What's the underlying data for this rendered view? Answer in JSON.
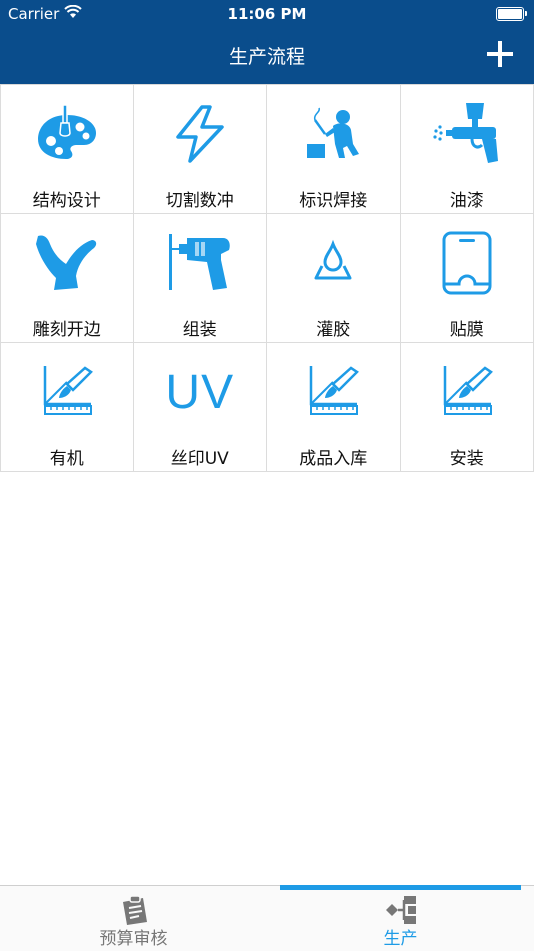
{
  "status_bar": {
    "carrier": "Carrier",
    "time": "11:06 PM"
  },
  "nav": {
    "title": "生产流程"
  },
  "grid": [
    {
      "label": "结构设计",
      "icon": "palette-icon"
    },
    {
      "label": "切割数冲",
      "icon": "lightning-icon"
    },
    {
      "label": "标识焊接",
      "icon": "welder-icon"
    },
    {
      "label": "油漆",
      "icon": "spray-gun-icon"
    },
    {
      "label": "雕刻开边",
      "icon": "engraving-icon"
    },
    {
      "label": "组装",
      "icon": "drill-icon"
    },
    {
      "label": "灌胶",
      "icon": "glue-drop-icon"
    },
    {
      "label": "贴膜",
      "icon": "phone-film-icon"
    },
    {
      "label": "有机",
      "icon": "ruler-brush-icon"
    },
    {
      "label": "丝印UV",
      "icon": "uv-icon",
      "icon_text": "UV"
    },
    {
      "label": "成品入库",
      "icon": "ruler-brush-icon"
    },
    {
      "label": "安装",
      "icon": "ruler-brush-icon"
    }
  ],
  "tabs": [
    {
      "label": "预算审核",
      "icon": "clipboard-icon",
      "active": false
    },
    {
      "label": "生产",
      "icon": "flow-icon",
      "active": true
    }
  ],
  "colors": {
    "bar": "#0a4d8c",
    "accent": "#1e9be6",
    "icon": "#1e9be6"
  }
}
